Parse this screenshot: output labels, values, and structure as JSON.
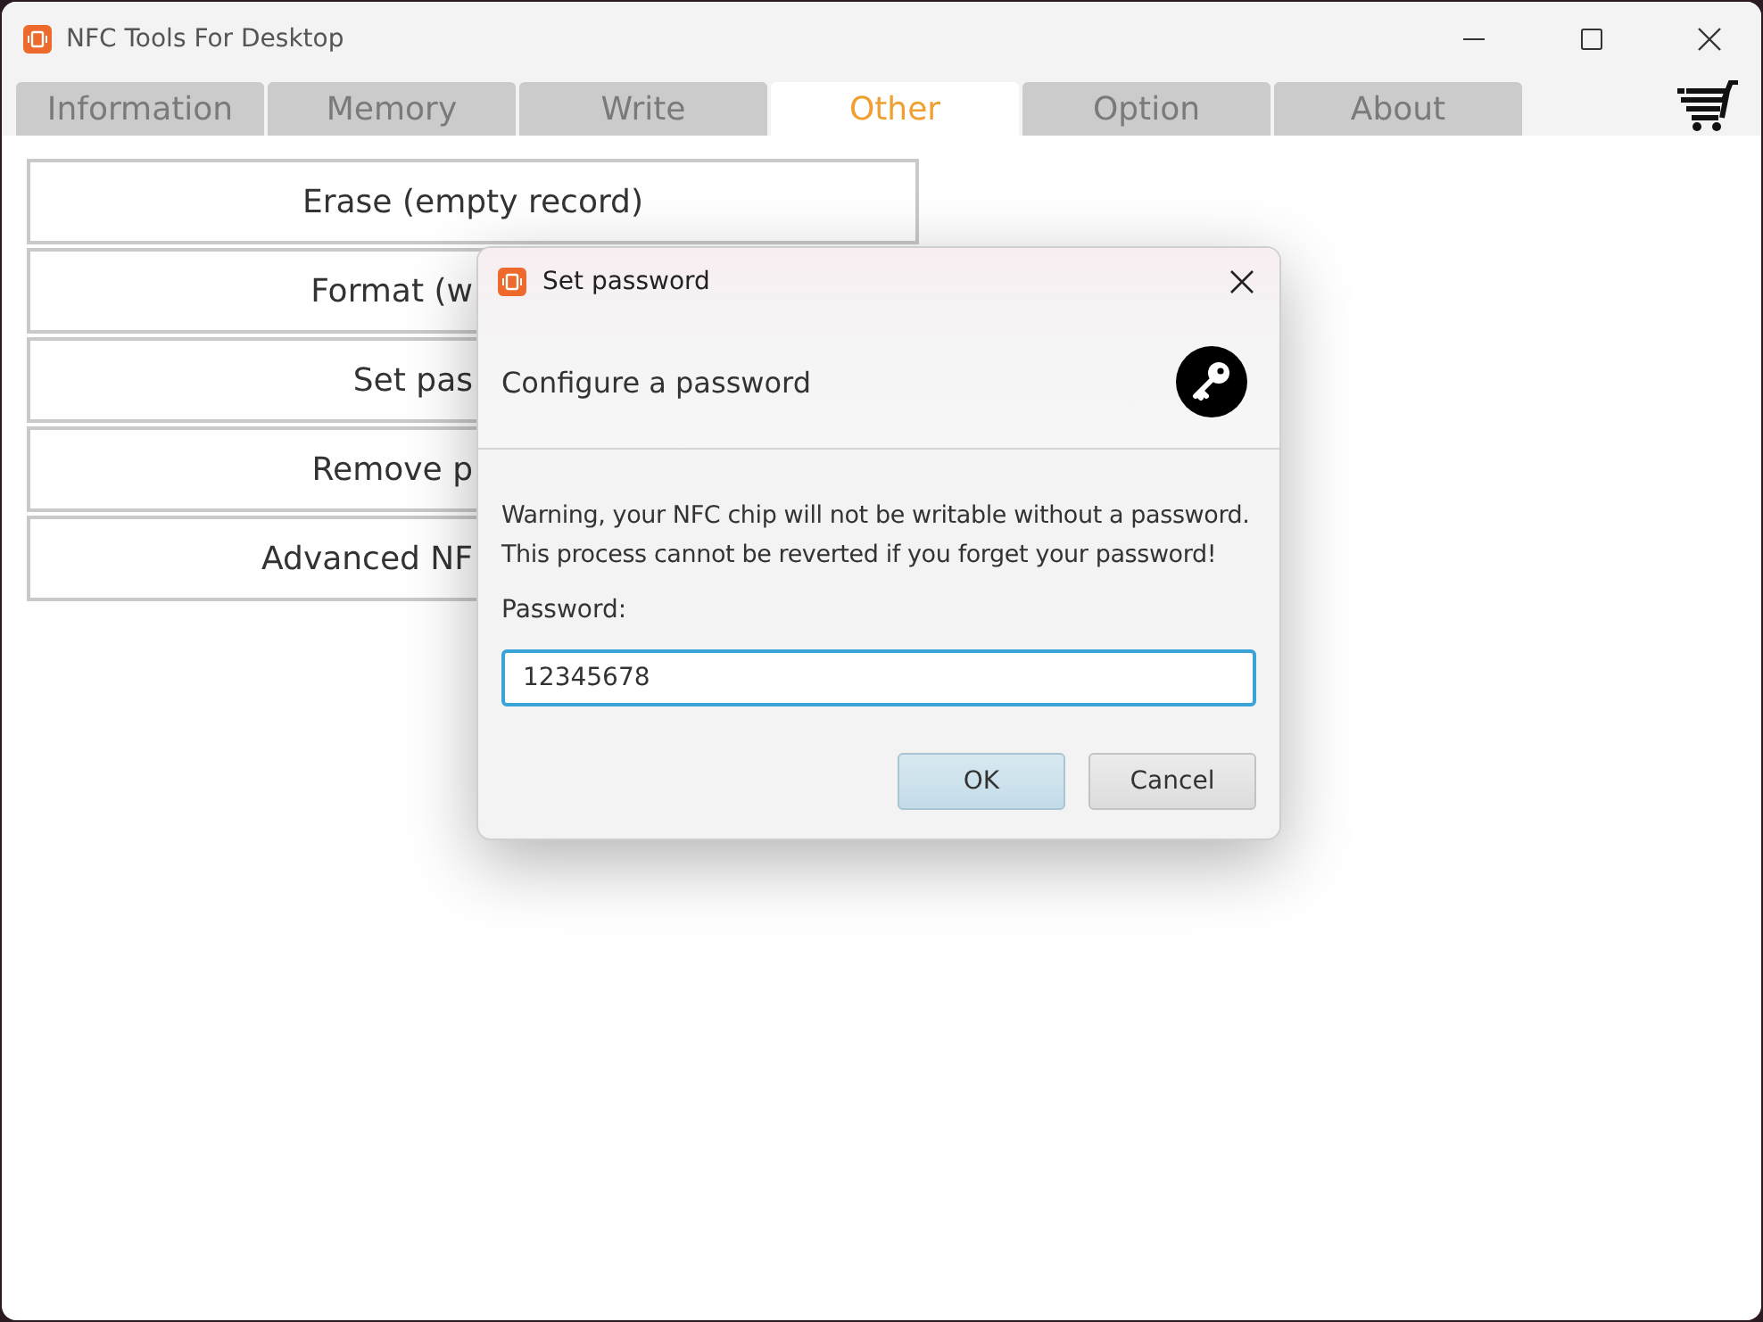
{
  "window": {
    "title": "NFC Tools For Desktop"
  },
  "tabs": [
    {
      "label": "Information",
      "selected": false
    },
    {
      "label": "Memory",
      "selected": false
    },
    {
      "label": "Write",
      "selected": false
    },
    {
      "label": "Other",
      "selected": true
    },
    {
      "label": "Option",
      "selected": false
    },
    {
      "label": "About",
      "selected": false
    }
  ],
  "actions": [
    {
      "label": "Erase (empty record)",
      "clipped": false
    },
    {
      "label": "Format (w",
      "clipped": true
    },
    {
      "label": "Set pas",
      "clipped": true
    },
    {
      "label": "Remove p",
      "clipped": true
    },
    {
      "label": "Advanced NF",
      "clipped": true
    }
  ],
  "dialog": {
    "title": "Set password",
    "heading": "Configure a password",
    "message": [
      "Warning, your NFC chip will not be writable without a password.",
      "This process cannot be reverted if you forget your password!"
    ],
    "field_label": "Password:",
    "value": "12345678",
    "buttons": [
      {
        "label": "OK",
        "kind": "default"
      },
      {
        "label": "Cancel",
        "kind": "normal"
      }
    ]
  }
}
